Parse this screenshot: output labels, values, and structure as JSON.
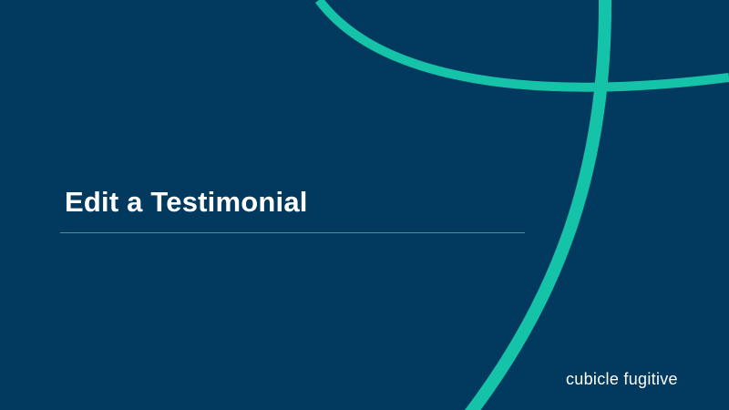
{
  "slide": {
    "title": "Edit a Testimonial",
    "brand": "cubicle fugitive"
  },
  "colors": {
    "background": "#013a5e",
    "accent": "#15c3a9",
    "title_text": "#ffffff",
    "divider": "#1fa6a6"
  }
}
